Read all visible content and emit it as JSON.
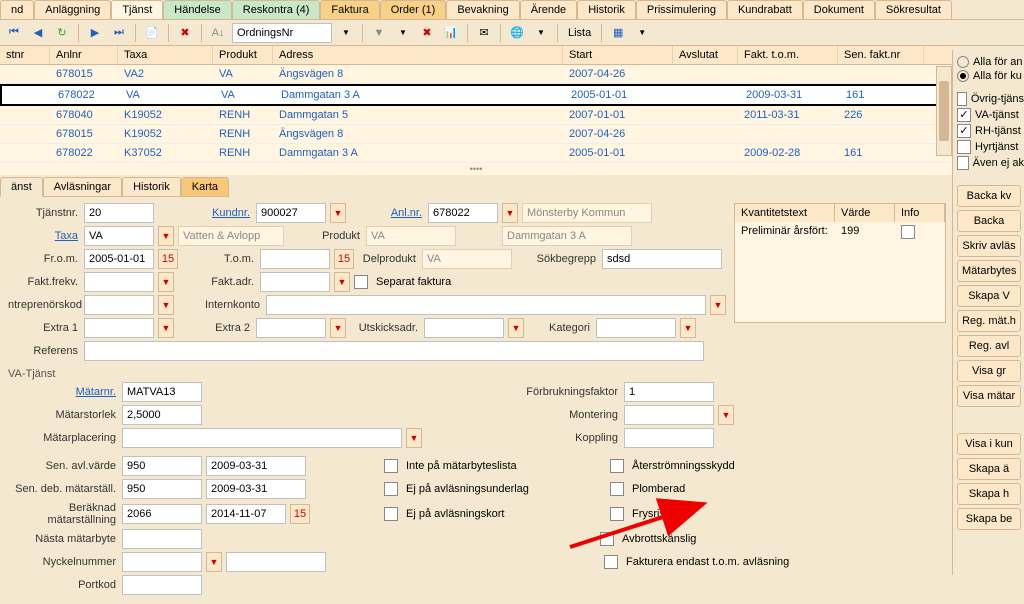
{
  "main_tabs": [
    "nd",
    "Anläggning",
    "Tjänst",
    "Händelse",
    "Reskontra (4)",
    "Faktura",
    "Order (1)",
    "Bevakning",
    "Ärende",
    "Historik",
    "Prissimulering",
    "Kundrabatt",
    "Dokument",
    "Sökresultat"
  ],
  "main_tabs_classes": [
    "",
    "",
    "active",
    "green",
    "green",
    "orange",
    "orange",
    "",
    "",
    "",
    "",
    "",
    "",
    ""
  ],
  "toolbar": {
    "dropdown": "OrdningsNr",
    "lista": "Lista"
  },
  "grid": {
    "headers": [
      "stnr",
      "Anlnr",
      "Taxa",
      "Produkt",
      "Adress",
      "Start",
      "Avslutat",
      "Fakt. t.o.m.",
      "Sen. fakt.nr"
    ],
    "rows": [
      {
        "anlnr": "678015",
        "taxa": "VA2",
        "prod": "VA",
        "adr": "Ängsvägen 8",
        "start": "2007-04-26",
        "avsl": "",
        "fakt": "",
        "sen": ""
      },
      {
        "anlnr": "678022",
        "taxa": "VA",
        "prod": "VA",
        "adr": "Dammgatan 3 A",
        "start": "2005-01-01",
        "avsl": "",
        "fakt": "2009-03-31",
        "sen": "161",
        "selected": true
      },
      {
        "anlnr": "678040",
        "taxa": "K19052",
        "prod": "RENH",
        "adr": "Dammgatan 5",
        "start": "2007-01-01",
        "avsl": "",
        "fakt": "2011-03-31",
        "sen": "226"
      },
      {
        "anlnr": "678015",
        "taxa": "K19052",
        "prod": "RENH",
        "adr": "Ängsvägen 8",
        "start": "2007-04-26",
        "avsl": "",
        "fakt": "",
        "sen": ""
      },
      {
        "anlnr": "678022",
        "taxa": "K37052",
        "prod": "RENH",
        "adr": "Dammgatan 3 A",
        "start": "2005-01-01",
        "avsl": "",
        "fakt": "2009-02-28",
        "sen": "161"
      }
    ]
  },
  "sub_tabs": [
    "änst",
    "Avläsningar",
    "Historik",
    "Karta"
  ],
  "form": {
    "tjanstnr_l": "Tjänstnr.",
    "tjanstnr": "20",
    "kundnr_l": "Kundnr.",
    "kundnr": "900027",
    "anlnr_l": "Anl.nr.",
    "anlnr": "678022",
    "kommun": "Mönsterby Kommun",
    "taxa_l": "Taxa",
    "taxa": "VA",
    "taxa_desc": "Vatten & Avlopp",
    "produkt_l": "Produkt",
    "produkt": "VA",
    "adr": "Dammgatan 3 A",
    "from_l": "Fr.o.m.",
    "from": "2005-01-01",
    "tom_l": "T.o.m.",
    "tom": "",
    "delprodukt_l": "Delprodukt",
    "delprodukt": "VA",
    "sokbegrepp_l": "Sökbegrepp",
    "sokbegrepp": "sdsd",
    "faktfrekv_l": "Fakt.frekv.",
    "faktadr_l": "Fakt.adr.",
    "separat_l": "Separat faktura",
    "entr_l": "ntreprenörskod",
    "intern_l": "Internkonto",
    "extra1_l": "Extra 1",
    "extra2_l": "Extra 2",
    "utskick_l": "Utskicksadr.",
    "kategori_l": "Kategori",
    "referens_l": "Referens"
  },
  "kv": {
    "h1": "Kvantitetstext",
    "h2": "Värde",
    "h3": "Info",
    "r1": "Preliminär årsfört:",
    "v1": "199"
  },
  "va": {
    "title": "VA-Tjänst",
    "matarnr_l": "Mätarnr.",
    "matarnr": "MATVA13",
    "forbruk_l": "Förbrukningsfaktor",
    "forbruk": "1",
    "storlek_l": "Mätarstorlek",
    "storlek": "2,5000",
    "montering_l": "Montering",
    "placering_l": "Mätarplacering",
    "koppling_l": "Koppling",
    "senavl_l": "Sen. avl.värde",
    "senavl": "950",
    "senavl_d": "2009-03-31",
    "inte_l": "Inte på mätarbyteslista",
    "ater_l": "Återströmningsskydd",
    "sendeb_l": "Sen. deb. mätarställ.",
    "sendeb": "950",
    "sendeb_d": "2009-03-31",
    "ejund_l": "Ej på avläsningsunderlag",
    "plomb_l": "Plomberad",
    "berak_l": "Beräknad mätarställning",
    "berak": "2066",
    "berak_d": "2014-11-07",
    "ejkort_l": "Ej på avläsningskort",
    "frys_l": "Frysrisk",
    "nasta_l": "Nästa mätarbyte",
    "avbrott_l": "Avbrottskänslig",
    "nyckel_l": "Nyckelnummer",
    "faktend_l": "Fakturera endast t.o.m. avläsning",
    "portkod_l": "Portkod"
  },
  "right": {
    "r1": "Alla för an",
    "r2": "Alla för ku",
    "c1": "Övrig-tjäns",
    "c2": "VA-tjänst",
    "c3": "RH-tjänst",
    "c4": "Hyrtjänst",
    "c5": "Även ej ak",
    "btns": [
      "Backa kv",
      "Backa",
      "Skriv avläs",
      "Mätarbytes",
      "Skapa V",
      "Reg. mät.h",
      "Reg. avl",
      "Visa gr",
      "Visa mätar",
      "Visa i kun",
      "Skapa ä",
      "Skapa h",
      "Skapa be"
    ]
  }
}
